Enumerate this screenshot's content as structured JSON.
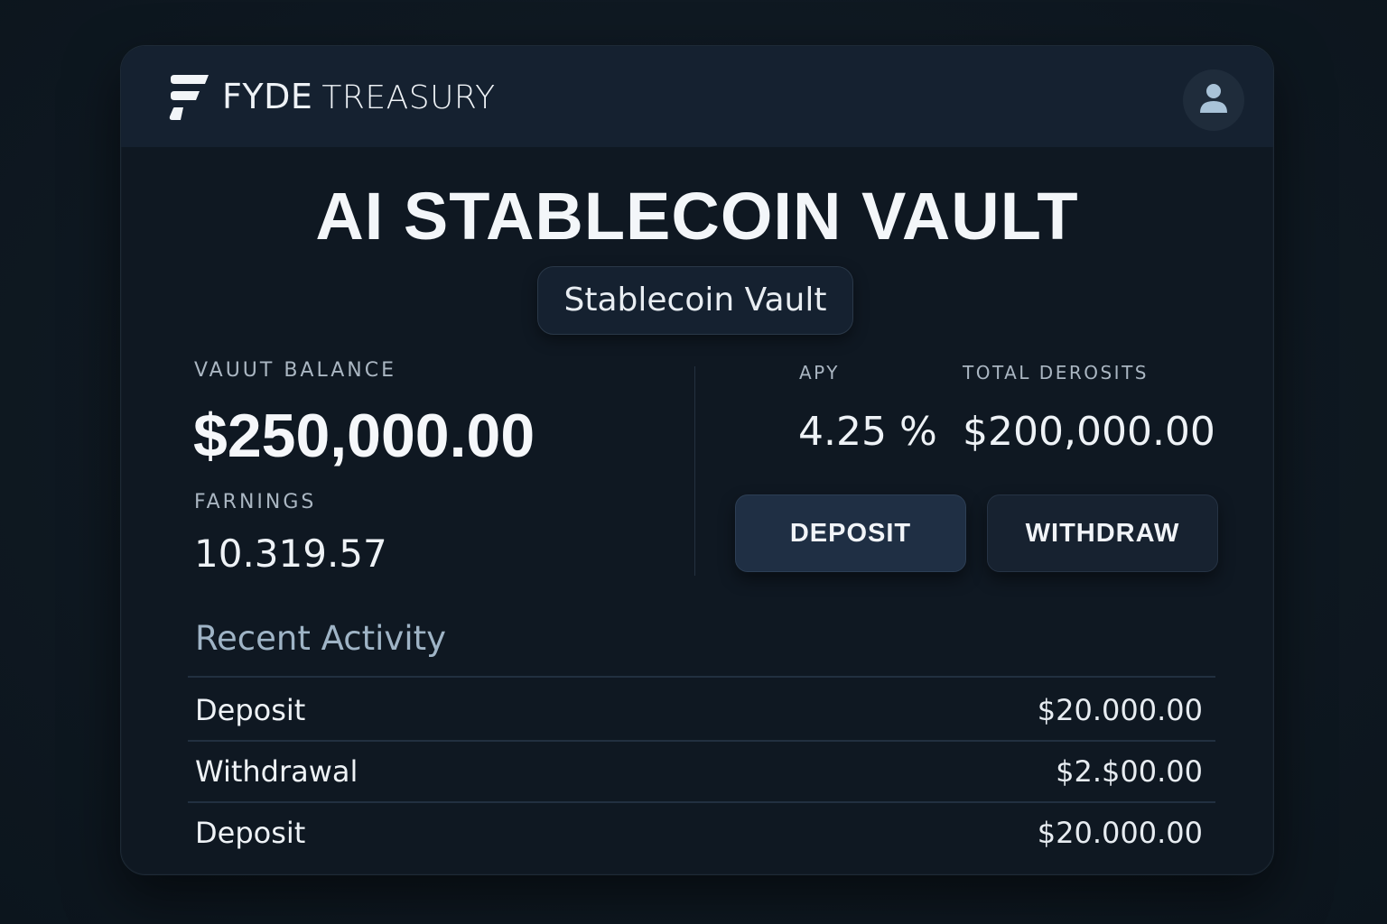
{
  "header": {
    "brand_part1": "FYDE",
    "brand_part2": "TREASURY",
    "avatar_icon": "user-icon",
    "logo_icon": "fyde-logo-icon"
  },
  "main": {
    "title": "AI STABLECOIN VAULT",
    "vault_type_label": "Stablecoin Vault"
  },
  "stats": {
    "vault_balance_label": "VAUUT BALANCE",
    "vault_balance_value": "$250,000.00",
    "earnings_label": "FARNINGS",
    "earnings_value": "10.319.57",
    "apy_label": "APY",
    "apy_value": "4.25 %",
    "total_deposits_label": "TOTAL DEROSITS",
    "total_deposits_value": "$200,000.00"
  },
  "actions": {
    "deposit_label": "DEPOSIT",
    "withdraw_label": "WITHDRAW"
  },
  "activity": {
    "title": "Recent Activity",
    "rows": [
      {
        "type": "Deposit",
        "amount": "$20.000.00"
      },
      {
        "type": "Withdrawal",
        "amount": "$2.$00.00"
      },
      {
        "type": "Deposit",
        "amount": "$20.000.00"
      }
    ]
  },
  "colors": {
    "background": "#0f1922",
    "card": "#0f1822",
    "topbar": "#152130",
    "deposit_button": "#1f2f44",
    "withdraw_button": "#172230",
    "accent_text": "#9fb4c6"
  }
}
